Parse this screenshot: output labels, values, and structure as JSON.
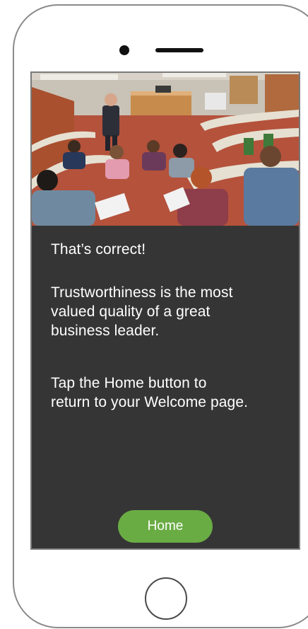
{
  "screen": {
    "photo_icon": "lecture-hall-photo",
    "messages": {
      "correct": "That’s correct!",
      "explanation": "Trustworthiness is the most\nvalued quality of a great\nbusiness leader.",
      "instruction": "Tap the Home button to\nreturn to your Welcome page."
    },
    "home_button_label": "Home"
  },
  "colors": {
    "screen_background": "#353535",
    "button": "#6aac44",
    "text": "#ffffff",
    "device_outline": "#8a8a8a"
  }
}
